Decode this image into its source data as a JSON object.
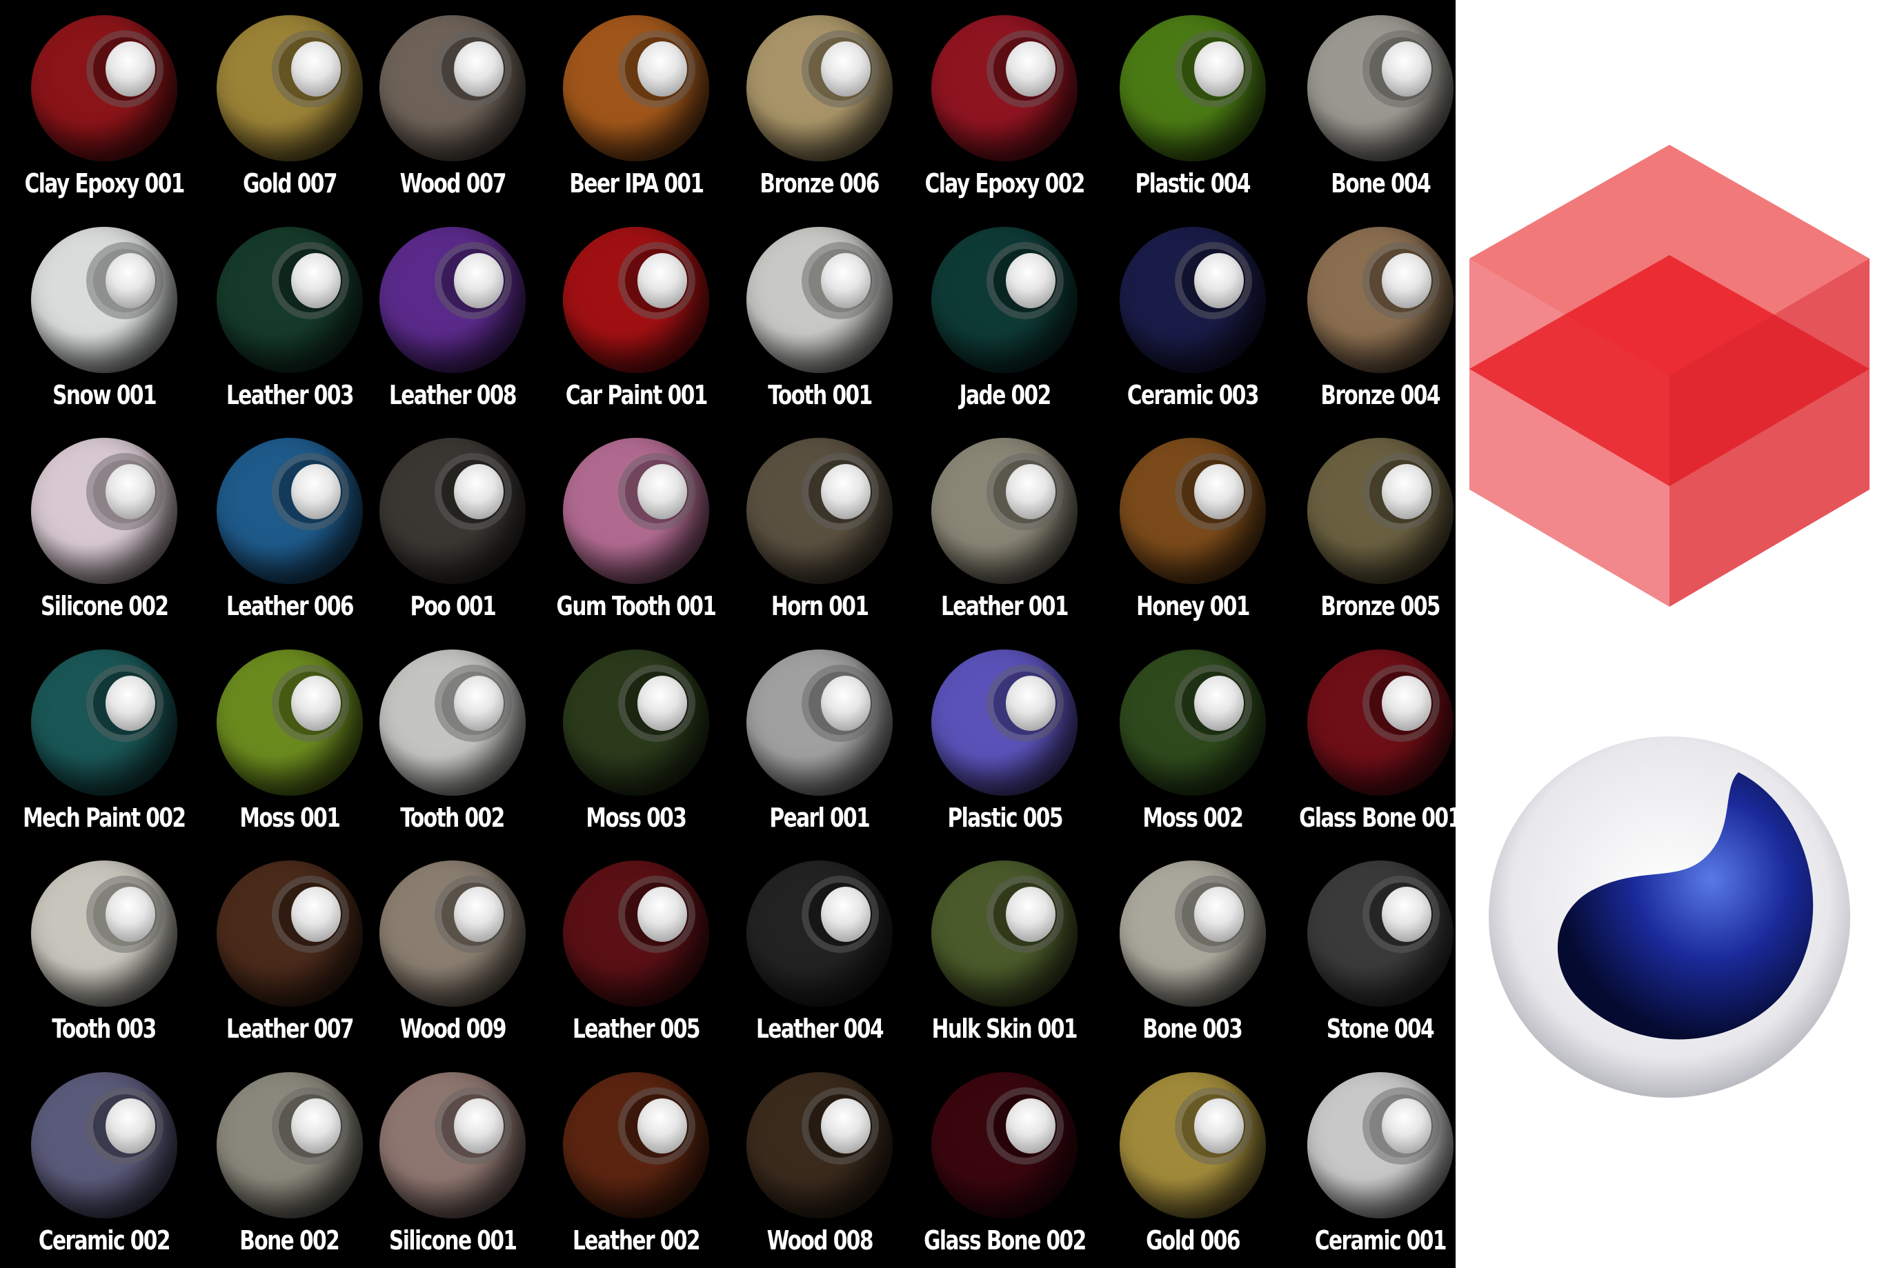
{
  "materials": [
    {
      "name": "Clay Epoxy 001",
      "color": "#8a1418"
    },
    {
      "name": "Gold 007",
      "color": "#9a8236"
    },
    {
      "name": "Wood 007",
      "color": "#6e6258"
    },
    {
      "name": "Beer IPA 001",
      "color": "#a0561a"
    },
    {
      "name": "Bronze 006",
      "color": "#a89468"
    },
    {
      "name": "Clay Epoxy 002",
      "color": "#8e1420"
    },
    {
      "name": "Plastic 004",
      "color": "#4a7a14"
    },
    {
      "name": "Bone 004",
      "color": "#9a9890"
    },
    {
      "name": "Snow 001",
      "color": "#dadcdc"
    },
    {
      "name": "Leather 003",
      "color": "#153a2a"
    },
    {
      "name": "Leather 008",
      "color": "#5a2a8a"
    },
    {
      "name": "Car Paint 001",
      "color": "#a01012"
    },
    {
      "name": "Tooth 001",
      "color": "#c8c8c4"
    },
    {
      "name": "Jade 002",
      "color": "#0e3a36"
    },
    {
      "name": "Ceramic 003",
      "color": "#1a1c48"
    },
    {
      "name": "Bronze 004",
      "color": "#8a6e50"
    },
    {
      "name": "Silicone 002",
      "color": "#d8c8d0"
    },
    {
      "name": "Leather 006",
      "color": "#1e5a8a"
    },
    {
      "name": "Poo 001",
      "color": "#3a3632"
    },
    {
      "name": "Gum Tooth 001",
      "color": "#b06a90"
    },
    {
      "name": "Horn 001",
      "color": "#5a5040"
    },
    {
      "name": "Leather 001",
      "color": "#8a8676"
    },
    {
      "name": "Honey 001",
      "color": "#7a4a1a"
    },
    {
      "name": "Bronze 005",
      "color": "#6a6040"
    },
    {
      "name": "Mech Paint 002",
      "color": "#1a5656"
    },
    {
      "name": "Moss 001",
      "color": "#6a8a1e"
    },
    {
      "name": "Tooth 002",
      "color": "#c4c4c0"
    },
    {
      "name": "Moss 003",
      "color": "#2a3a1a"
    },
    {
      "name": "Pearl 001",
      "color": "#a0a0a0"
    },
    {
      "name": "Plastic 005",
      "color": "#5a52b8"
    },
    {
      "name": "Moss 002",
      "color": "#2e4a1c"
    },
    {
      "name": "Glass Bone 001",
      "color": "#6e0e16"
    },
    {
      "name": "Tooth 003",
      "color": "#c8c6bc"
    },
    {
      "name": "Leather 007",
      "color": "#4a2a1a"
    },
    {
      "name": "Wood 009",
      "color": "#8a7e70"
    },
    {
      "name": "Leather 005",
      "color": "#5a1014"
    },
    {
      "name": "Leather 004",
      "color": "#222222"
    },
    {
      "name": "Hulk Skin 001",
      "color": "#4a5a2a"
    },
    {
      "name": "Bone 003",
      "color": "#aaa89c"
    },
    {
      "name": "Stone 004",
      "color": "#3a3a3a"
    },
    {
      "name": "Ceramic 002",
      "color": "#5a5a7a"
    },
    {
      "name": "Bone 002",
      "color": "#8a887c"
    },
    {
      "name": "Silicone 001",
      "color": "#8e7670"
    },
    {
      "name": "Leather 002",
      "color": "#5a2410"
    },
    {
      "name": "Wood 008",
      "color": "#3a2a1c"
    },
    {
      "name": "Glass Bone 002",
      "color": "#3a060e"
    },
    {
      "name": "Gold 006",
      "color": "#a08a3a"
    },
    {
      "name": "Ceramic 001",
      "color": "#c8c8c8"
    }
  ],
  "logos": {
    "redshift": "Redshift",
    "cinema4d": "Cinema 4D"
  },
  "colors": {
    "background": "#000000",
    "label": "#ffffff",
    "redshift_red": "#e8262c",
    "c4d_blue": "#1a2a9a"
  }
}
